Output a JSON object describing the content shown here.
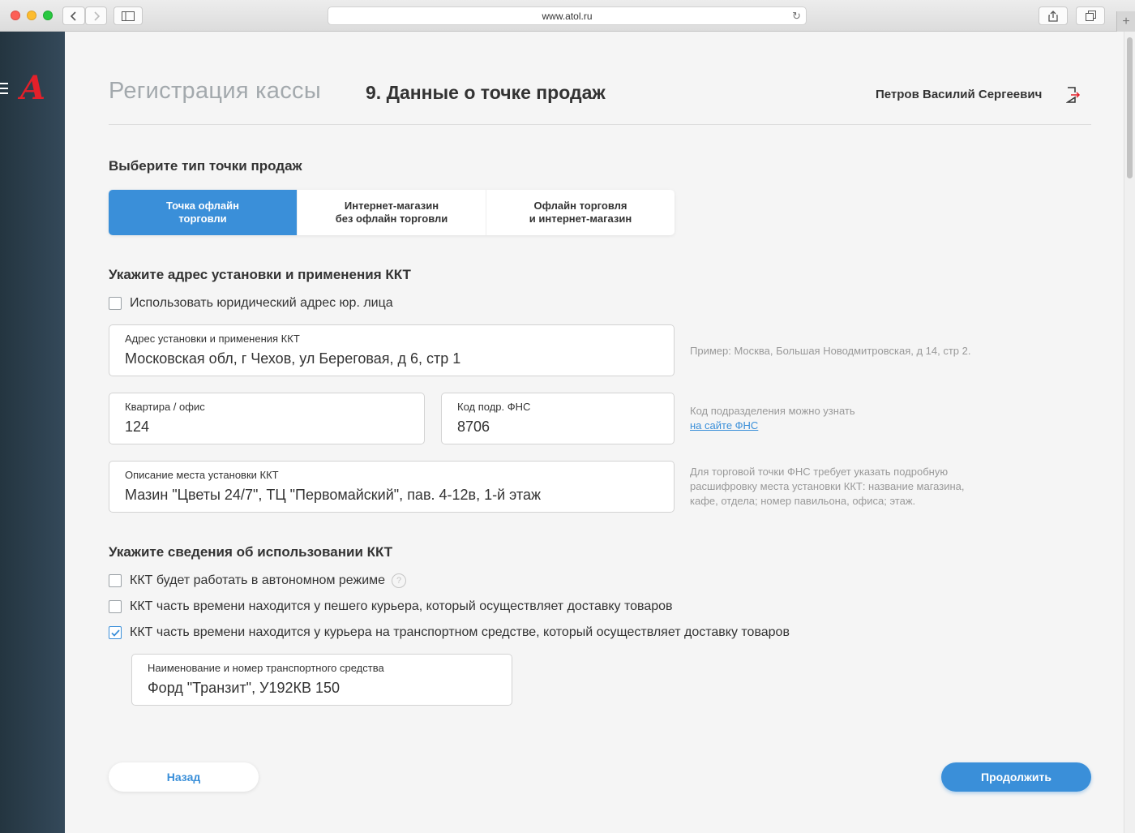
{
  "browser": {
    "url": "www.atol.ru"
  },
  "sidebar": {
    "logo_text": "A"
  },
  "header": {
    "page_title": "Регистрация кассы",
    "step_title": "9. Данные о точке продаж",
    "user_name": "Петров Василий Сергеевич"
  },
  "sale_type": {
    "title": "Выберите тип точки продаж",
    "options": [
      {
        "label": "Точка офлайн\nторговли"
      },
      {
        "label": "Интернет-магазин\nбез офлайн торговли"
      },
      {
        "label": "Офлайн торговля\nи интернет-магазин"
      }
    ]
  },
  "address": {
    "title": "Укажите адрес установки и применения ККТ",
    "use_legal_label": "Использовать юридический адрес юр. лица",
    "address_field": {
      "label": "Адрес установки и применения ККТ",
      "value": "Московская обл, г Чехов, ул Береговая, д 6, стр 1"
    },
    "address_hint": "Пример: Москва, Большая Новодмитровская, д 14, стр 2.",
    "office_field": {
      "label": "Квартира / офис",
      "value": "124"
    },
    "fns_field": {
      "label": "Код подр. ФНС",
      "value": "8706"
    },
    "fns_hint": "Код подразделения можно узнать",
    "fns_link": "на сайте ФНС",
    "place_field": {
      "label": "Описание места установки ККТ",
      "value": "Мазин \"Цветы 24/7\", ТЦ \"Первомайский\", пав. 4-12в, 1-й этаж"
    },
    "place_hint": "Для торговой точки ФНС требует указать подробную\nрасшифровку места установки ККТ: название магазина,\nкафе, отдела; номер павильона, офиса; этаж."
  },
  "usage": {
    "title": "Укажите сведения об использовании ККТ",
    "options": [
      {
        "label": "ККТ будет работать в автономном режиме",
        "checked": false
      },
      {
        "label": "ККТ часть времени находится у пешего курьера, который осуществляет доставку товаров",
        "checked": false
      },
      {
        "label": "ККТ часть времени находится у курьера на транспортном средстве, который осуществляет доставку товаров",
        "checked": true
      }
    ],
    "help_symbol": "?",
    "vehicle_field": {
      "label": "Наименование и номер транспортного средства",
      "value": "Форд \"Транзит\", У192КВ 150"
    }
  },
  "actions": {
    "back_label": "Назад",
    "next_label": "Продолжить"
  },
  "colors": {
    "accent": "#3a8fd9",
    "logo_red": "#e3202a",
    "sidebar": "#2b3d4a"
  }
}
